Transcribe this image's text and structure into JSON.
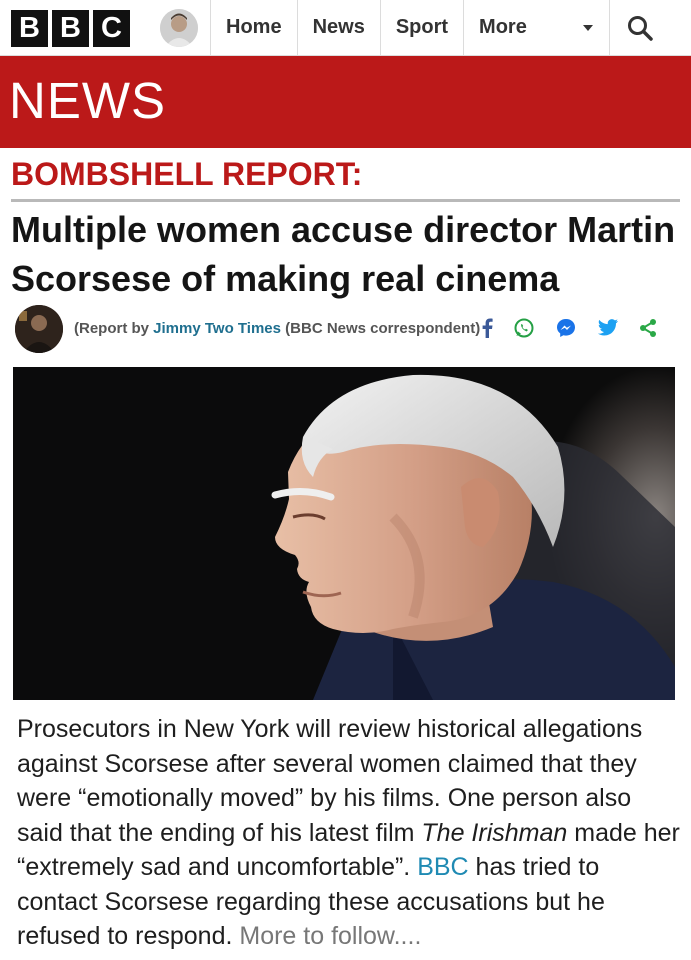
{
  "brand": {
    "letters": [
      "B",
      "B",
      "C"
    ],
    "news_wordmark": "NEWS",
    "red": "#bb1919"
  },
  "nav": {
    "items": [
      {
        "label": "Home"
      },
      {
        "label": "News"
      },
      {
        "label": "Sport"
      },
      {
        "label": "More"
      }
    ],
    "more_icon": "caret-down-icon",
    "search_icon": "search-icon"
  },
  "article": {
    "kicker": "BOMBSHELL REPORT:",
    "headline": "Multiple women accuse director Martin Scorsese of making real cinema",
    "byline": {
      "prefix": "(Report by ",
      "author": "Jimmy Two Times",
      "suffix": " (BBC News correspondent)"
    },
    "share_icons": [
      "facebook-icon",
      "whatsapp-icon",
      "messenger-icon",
      "twitter-icon",
      "share-icon"
    ],
    "body": {
      "part1": "Prosecutors in New York will review historical allegations against Scorsese after several women claimed that they were “emotionally moved” by his films. One person also said that the ending of his latest film ",
      "film_title": "The Irishman",
      "part2": " made her “extremely sad and uncomfortable”. ",
      "link": "BBC",
      "part3": " has tried to contact Scorsese regarding these accusations but he refused to respond. ",
      "more": "More to follow...."
    }
  }
}
